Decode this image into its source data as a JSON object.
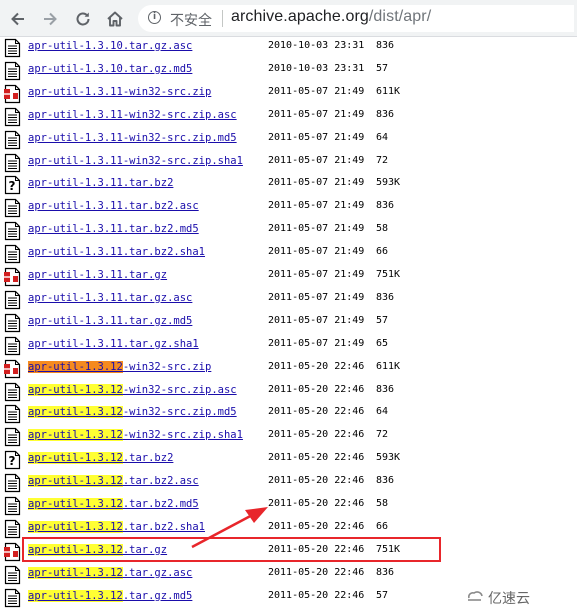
{
  "browser": {
    "security_label": "不安全",
    "url_domain": "archive.apache.org",
    "url_path": "/dist/apr/",
    "back_icon": "back-arrow-icon",
    "forward_icon": "forward-arrow-icon",
    "reload_icon": "reload-icon",
    "home_icon": "home-icon",
    "info_icon": "info-icon"
  },
  "files": [
    {
      "name": "apr-util-1.3.10.tar.gz.asc",
      "date": "2010-10-03 23:31",
      "size": "836",
      "icon": "text"
    },
    {
      "name": "apr-util-1.3.10.tar.gz.md5",
      "date": "2010-10-03 23:31",
      "size": "57",
      "icon": "text"
    },
    {
      "name": "apr-util-1.3.11-win32-src.zip",
      "date": "2011-05-07 21:49",
      "size": "611K",
      "icon": "compressed"
    },
    {
      "name": "apr-util-1.3.11-win32-src.zip.asc",
      "date": "2011-05-07 21:49",
      "size": "836",
      "icon": "text"
    },
    {
      "name": "apr-util-1.3.11-win32-src.zip.md5",
      "date": "2011-05-07 21:49",
      "size": "64",
      "icon": "text"
    },
    {
      "name": "apr-util-1.3.11-win32-src.zip.sha1",
      "date": "2011-05-07 21:49",
      "size": "72",
      "icon": "text"
    },
    {
      "name": "apr-util-1.3.11.tar.bz2",
      "date": "2011-05-07 21:49",
      "size": "593K",
      "icon": "unknown"
    },
    {
      "name": "apr-util-1.3.11.tar.bz2.asc",
      "date": "2011-05-07 21:49",
      "size": "836",
      "icon": "text"
    },
    {
      "name": "apr-util-1.3.11.tar.bz2.md5",
      "date": "2011-05-07 21:49",
      "size": "58",
      "icon": "text"
    },
    {
      "name": "apr-util-1.3.11.tar.bz2.sha1",
      "date": "2011-05-07 21:49",
      "size": "66",
      "icon": "text"
    },
    {
      "name": "apr-util-1.3.11.tar.gz",
      "date": "2011-05-07 21:49",
      "size": "751K",
      "icon": "compressed"
    },
    {
      "name": "apr-util-1.3.11.tar.gz.asc",
      "date": "2011-05-07 21:49",
      "size": "836",
      "icon": "text"
    },
    {
      "name": "apr-util-1.3.11.tar.gz.md5",
      "date": "2011-05-07 21:49",
      "size": "57",
      "icon": "text"
    },
    {
      "name": "apr-util-1.3.11.tar.gz.sha1",
      "date": "2011-05-07 21:49",
      "size": "65",
      "icon": "text"
    },
    {
      "name": "apr-util-1.3.12-win32-src.zip",
      "date": "2011-05-20 22:46",
      "size": "611K",
      "icon": "compressed",
      "hl_prefix": "apr-util-1.3.12",
      "hl_color": "orange"
    },
    {
      "name": "apr-util-1.3.12-win32-src.zip.asc",
      "date": "2011-05-20 22:46",
      "size": "836",
      "icon": "text",
      "hl_prefix": "apr-util-1.3.12",
      "hl_color": "yellow"
    },
    {
      "name": "apr-util-1.3.12-win32-src.zip.md5",
      "date": "2011-05-20 22:46",
      "size": "64",
      "icon": "text",
      "hl_prefix": "apr-util-1.3.12",
      "hl_color": "yellow"
    },
    {
      "name": "apr-util-1.3.12-win32-src.zip.sha1",
      "date": "2011-05-20 22:46",
      "size": "72",
      "icon": "text",
      "hl_prefix": "apr-util-1.3.12",
      "hl_color": "yellow"
    },
    {
      "name": "apr-util-1.3.12.tar.bz2",
      "date": "2011-05-20 22:46",
      "size": "593K",
      "icon": "unknown",
      "hl_prefix": "apr-util-1.3.12",
      "hl_color": "yellow"
    },
    {
      "name": "apr-util-1.3.12.tar.bz2.asc",
      "date": "2011-05-20 22:46",
      "size": "836",
      "icon": "text",
      "hl_prefix": "apr-util-1.3.12",
      "hl_color": "yellow"
    },
    {
      "name": "apr-util-1.3.12.tar.bz2.md5",
      "date": "2011-05-20 22:46",
      "size": "58",
      "icon": "text",
      "hl_prefix": "apr-util-1.3.12",
      "hl_color": "yellow"
    },
    {
      "name": "apr-util-1.3.12.tar.bz2.sha1",
      "date": "2011-05-20 22:46",
      "size": "66",
      "icon": "text",
      "hl_prefix": "apr-util-1.3.12",
      "hl_color": "yellow"
    },
    {
      "name": "apr-util-1.3.12.tar.gz",
      "date": "2011-05-20 22:46",
      "size": "751K",
      "icon": "compressed",
      "hl_prefix": "apr-util-1.3.12",
      "hl_color": "yellow",
      "boxed": true
    },
    {
      "name": "apr-util-1.3.12.tar.gz.asc",
      "date": "2011-05-20 22:46",
      "size": "836",
      "icon": "text",
      "hl_prefix": "apr-util-1.3.12",
      "hl_color": "yellow"
    },
    {
      "name": "apr-util-1.3.12.tar.gz.md5",
      "date": "2011-05-20 22:46",
      "size": "57",
      "icon": "text",
      "hl_prefix": "apr-util-1.3.12",
      "hl_color": "yellow"
    }
  ],
  "annotation": {
    "color": "#e8262b",
    "highlight_yellow": "#ffff33",
    "highlight_orange": "#f58a1f"
  },
  "watermark": {
    "text": "亿速云",
    "icon": "yisu-cloud-logo-icon"
  }
}
